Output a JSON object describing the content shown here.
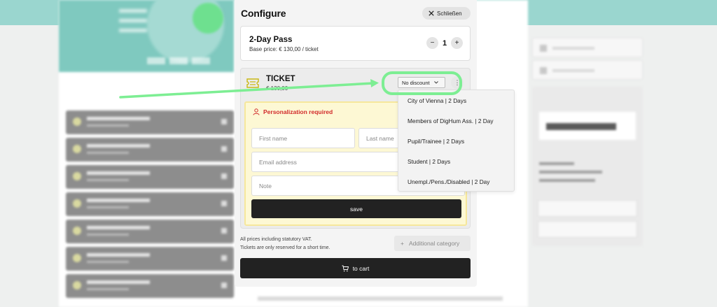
{
  "panel": {
    "title": "Configure",
    "close_label": "Schließen"
  },
  "pass": {
    "name": "2-Day Pass",
    "base_price": "Base price: € 130,00 / ticket",
    "quantity": "1",
    "minus": "−",
    "plus": "+"
  },
  "ticket": {
    "title": "TICKET",
    "price": "€ 130,00",
    "discount_selected": "No discount",
    "more": "⋮"
  },
  "personalization": {
    "label": "Personalization required",
    "first_name_placeholder": "First name",
    "last_name_placeholder": "Last name",
    "email_placeholder": "Email address",
    "note_placeholder": "Note",
    "save_label": "save"
  },
  "footer": {
    "vat_line1": "All prices including statutory VAT.",
    "vat_line2": "Tickets are only reserved for a short time.",
    "add_category_label": "Additional category",
    "cart_label": "to cart"
  },
  "dropdown": {
    "options": [
      "City of Vienna | 2 Days",
      "Members of DigHum Ass. | 2 Day",
      "Pupil/Trainee | 2 Days",
      "Student | 2 Days",
      "Unempl./Pens./Disabled | 2 Day"
    ]
  },
  "annotation": {
    "highlight_color": "#7dee93"
  }
}
